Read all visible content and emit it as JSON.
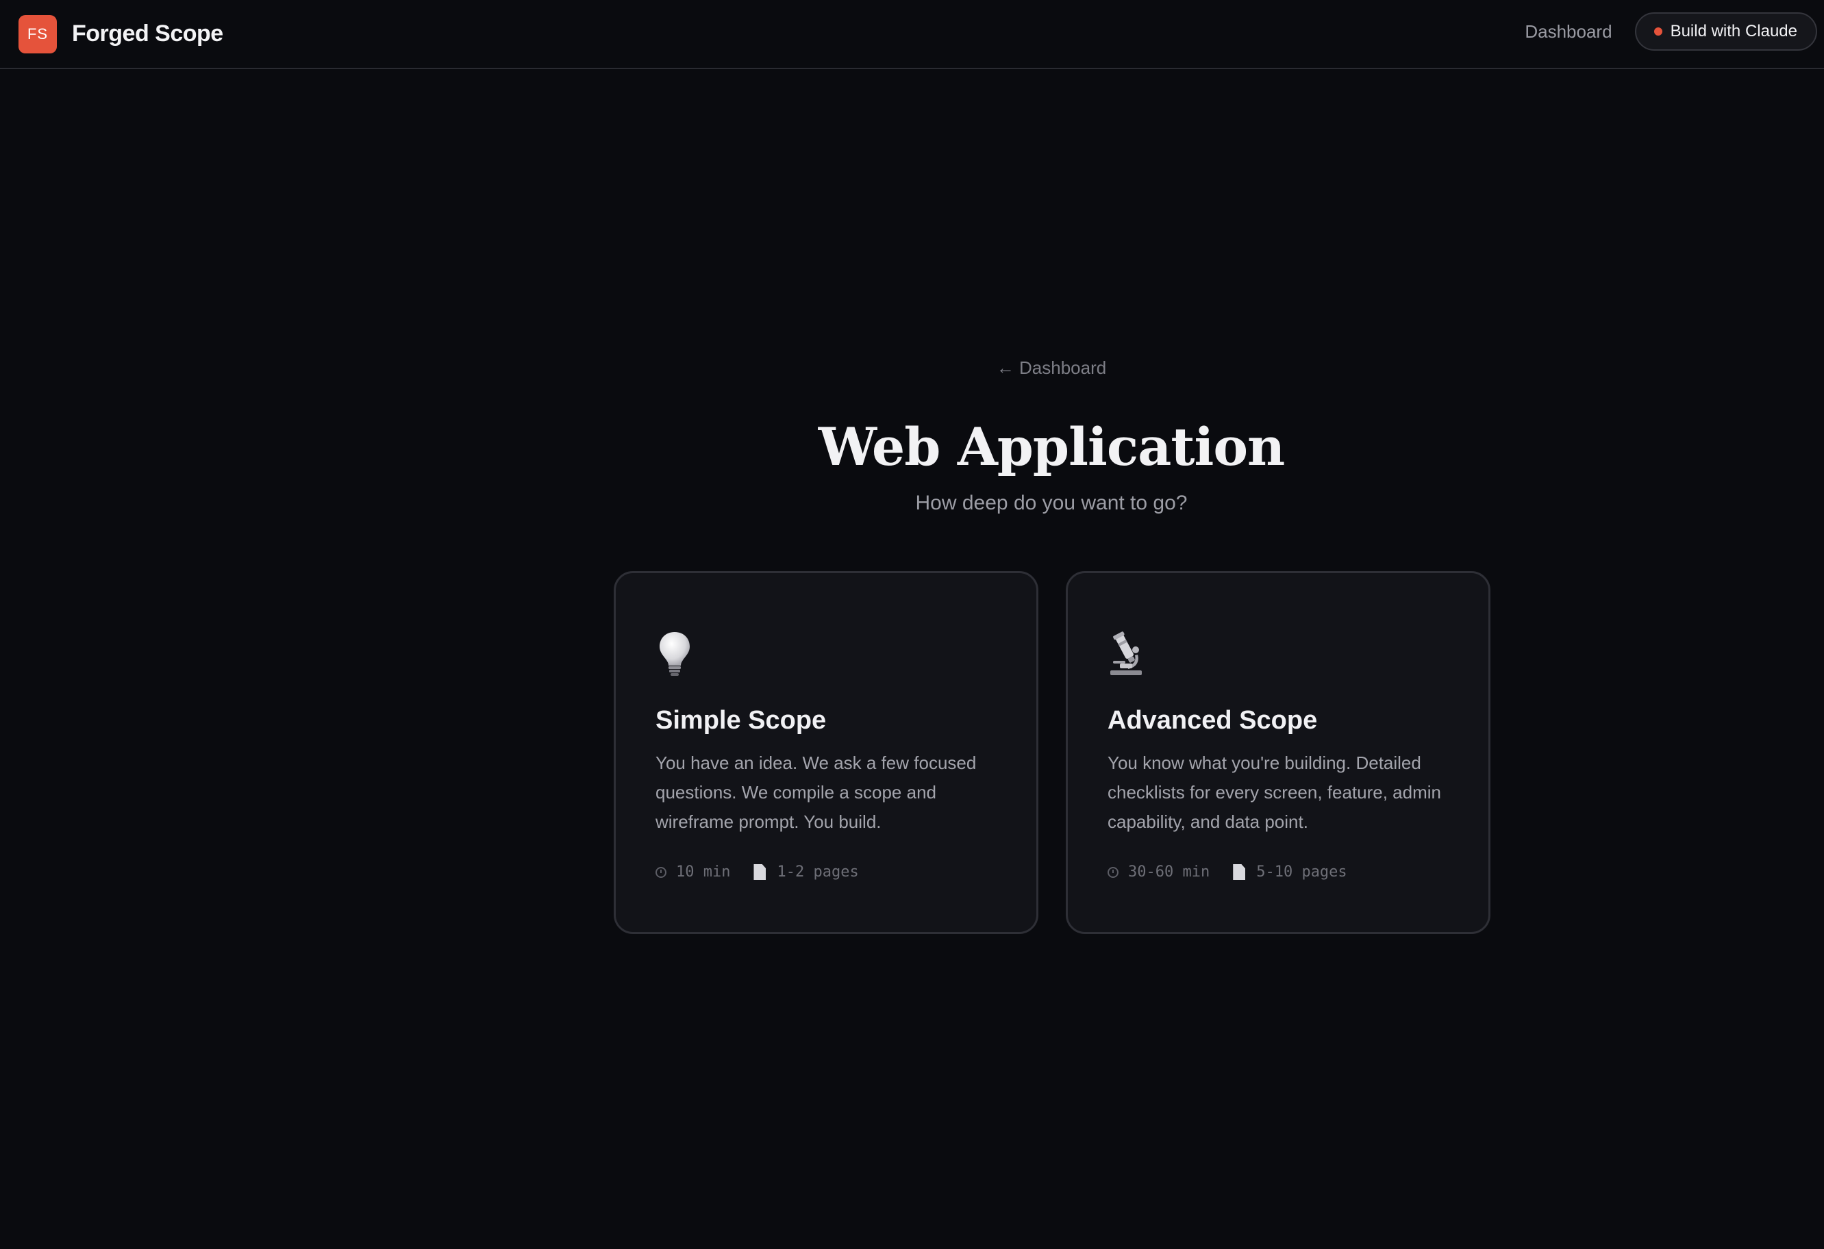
{
  "header": {
    "logo_text": "FS",
    "brand_name": "Forged Scope",
    "nav_dashboard": "Dashboard",
    "build_button": "Build with Claude"
  },
  "main": {
    "back_link": "← Dashboard",
    "title": "Web Application",
    "subtitle": "How deep do you want to go?"
  },
  "cards": [
    {
      "icon": "lightbulb-icon",
      "title": "Simple Scope",
      "description": "You have an idea. We ask a few focused questions. We compile a scope and wireframe prompt. You build.",
      "time": "10 min",
      "pages": "1-2 pages"
    },
    {
      "icon": "microscope-icon",
      "title": "Advanced Scope",
      "description": "You know what you're building. Detailed checklists for every screen, feature, admin capability, and data point.",
      "time": "30-60 min",
      "pages": "5-10 pages"
    }
  ],
  "colors": {
    "background": "#0a0b0f",
    "card_background": "#121318",
    "accent": "#e5533b"
  }
}
